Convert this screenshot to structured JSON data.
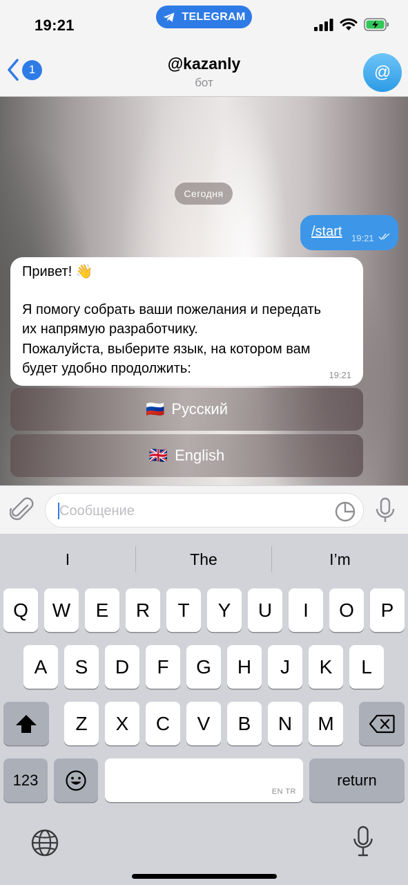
{
  "status_bar": {
    "time": "19:21",
    "app_pill": "TELEGRAM",
    "cellular_icon": "signal-bars-icon",
    "wifi_icon": "wifi-icon",
    "battery_icon": "battery-charging-icon"
  },
  "header": {
    "back_badge": "1",
    "title": "@kazanly",
    "subtitle": "бот",
    "avatar_glyph": "@"
  },
  "chat": {
    "date_label": "Сегодня",
    "outgoing": {
      "text": "/start",
      "time": "19:21",
      "status_icon": "double-check-icon"
    },
    "incoming": {
      "lines": [
        "Привет! 👋",
        "",
        "Я помогу собрать ваши пожелания и передать",
        "их напрямую разработчику.",
        "Пожалуйста, выберите язык, на котором вам",
        "будет удобно продолжить:"
      ],
      "time": "19:21"
    },
    "inline_buttons": [
      {
        "flag": "🇷🇺",
        "label": "Русский"
      },
      {
        "flag": "🇬🇧",
        "label": "English"
      }
    ]
  },
  "input_bar": {
    "placeholder": "Сообщение",
    "value": "",
    "attach_icon": "paperclip-icon",
    "sticker_icon": "sticker-icon",
    "mic_icon": "microphone-icon"
  },
  "keyboard": {
    "suggestions": [
      "I",
      "The",
      "I’m"
    ],
    "row1": [
      "Q",
      "W",
      "E",
      "R",
      "T",
      "Y",
      "U",
      "I",
      "O",
      "P"
    ],
    "row2": [
      "A",
      "S",
      "D",
      "F",
      "G",
      "H",
      "J",
      "K",
      "L"
    ],
    "row3": [
      "Z",
      "X",
      "C",
      "V",
      "B",
      "N",
      "M"
    ],
    "shift_icon": "shift-icon",
    "delete_icon": "backspace-icon",
    "numbers_label": "123",
    "emoji_icon": "emoji-icon",
    "space_lang": "EN TR",
    "return_label": "return",
    "globe_icon": "globe-icon",
    "dictation_icon": "microphone-icon"
  },
  "colors": {
    "accent": "#2e7be6",
    "outgoing_bubble": "#3d96e8",
    "keyboard_bg": "#d1d3d9"
  }
}
